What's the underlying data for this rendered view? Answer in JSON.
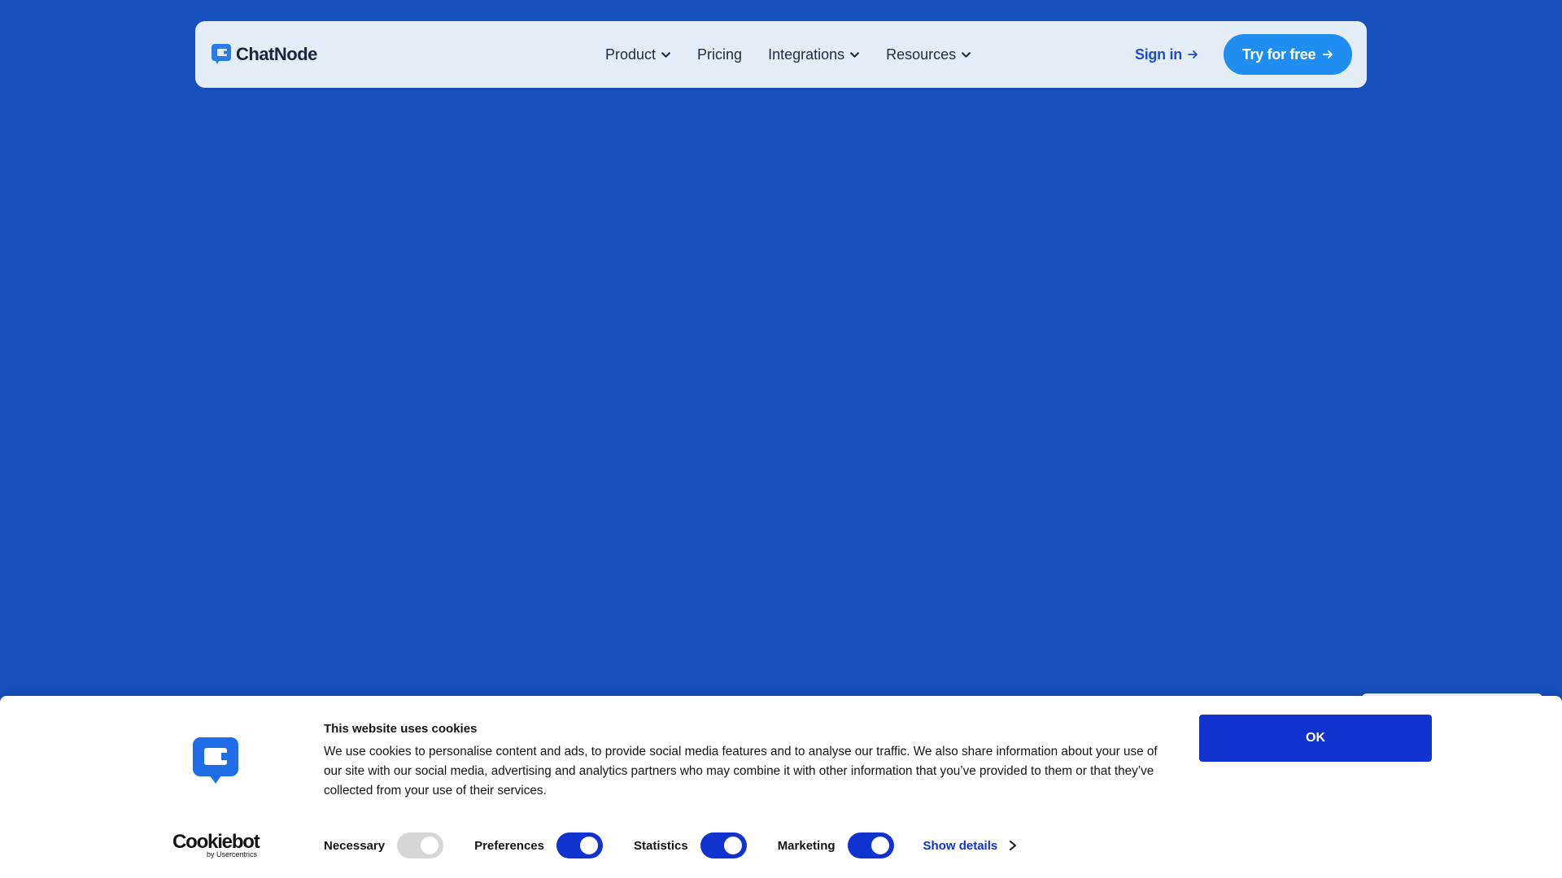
{
  "brand": {
    "name": "ChatNode",
    "accent_color": "#1f8ef0",
    "background_color": "#1550bd"
  },
  "nav": {
    "items": [
      {
        "label": "Product",
        "has_dropdown": true
      },
      {
        "label": "Pricing",
        "has_dropdown": false
      },
      {
        "label": "Integrations",
        "has_dropdown": true
      },
      {
        "label": "Resources",
        "has_dropdown": true
      }
    ],
    "signin_label": "Sign in",
    "cta_label": "Try for free"
  },
  "cookie_banner": {
    "title": "This website uses cookies",
    "text": "We use cookies to personalise content and ads, to provide social media features and to analyse our traffic. We also share information about your use of our site with our social media, advertising and analytics partners who may combine it with other information that you’ve provided to them or that they’ve collected from your use of their services.",
    "ok_label": "OK",
    "provider_name": "Cookiebot",
    "provider_byline": "by Usercentrics",
    "toggles": [
      {
        "label": "Necessary",
        "checked": true,
        "disabled": true
      },
      {
        "label": "Preferences",
        "checked": true,
        "disabled": false
      },
      {
        "label": "Statistics",
        "checked": true,
        "disabled": false
      },
      {
        "label": "Marketing",
        "checked": true,
        "disabled": false
      }
    ],
    "show_details_label": "Show details",
    "accent_color": "#1032cf"
  }
}
